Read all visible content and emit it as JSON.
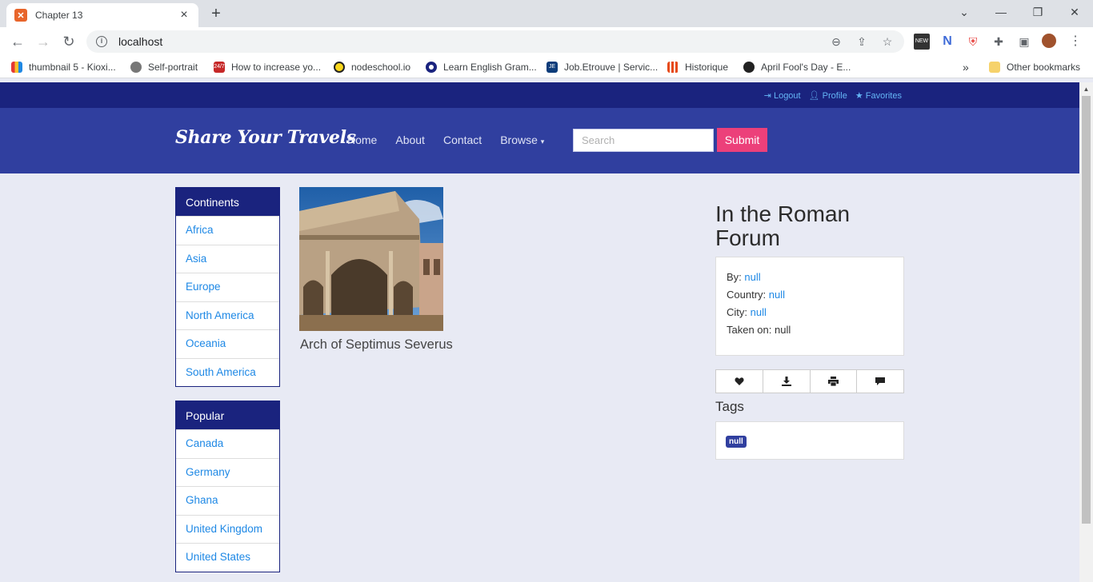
{
  "browser": {
    "tab_title": "Chapter 13",
    "url": "localhost",
    "bookmarks": [
      "thumbnail 5 - Kioxi...",
      "Self-portrait",
      "How to increase yo...",
      "nodeschool.io",
      "Learn English Gram...",
      "Job.Etrouve | Servic...",
      "Historique",
      "April Fool's Day - E..."
    ],
    "other_bookmarks": "Other bookmarks"
  },
  "topbar": {
    "logout": "Logout",
    "profile": "Profile",
    "favorites": "Favorites"
  },
  "header": {
    "brand": "Share Your Travels",
    "nav": [
      "Home",
      "About",
      "Contact",
      "Browse"
    ],
    "search_placeholder": "Search",
    "submit": "Submit"
  },
  "sidebar": {
    "continents_title": "Continents",
    "continents": [
      "Africa",
      "Asia",
      "Europe",
      "North America",
      "Oceania",
      "South America"
    ],
    "popular_title": "Popular",
    "popular": [
      "Canada",
      "Germany",
      "Ghana",
      "United Kingdom",
      "United States"
    ]
  },
  "photo": {
    "caption": "Arch of Septimus Severus"
  },
  "details": {
    "title": "In the Roman Forum",
    "by_label": "By:",
    "by_value": "null",
    "country_label": "Country:",
    "country_value": "null",
    "city_label": "City:",
    "city_value": "null",
    "taken_label": "Taken on:",
    "taken_value": "null",
    "tags_title": "Tags",
    "tags": [
      "null"
    ]
  },
  "colors": {
    "topbar": "#1a237e",
    "header": "#303f9f",
    "accent": "#ec407a",
    "link": "#1e88e5",
    "background": "#e8eaf4"
  }
}
